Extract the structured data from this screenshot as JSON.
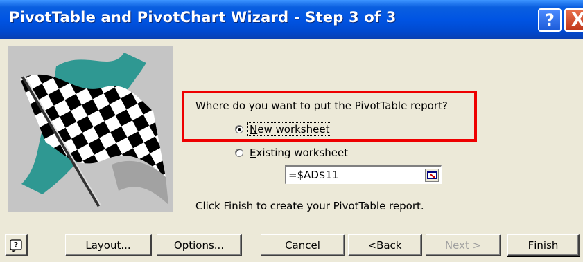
{
  "window": {
    "title": "PivotTable and PivotChart Wizard - Step 3 of 3",
    "help_glyph": "?",
    "close_glyph": "X"
  },
  "main": {
    "prompt": "Where do you want to put the PivotTable report?",
    "options": [
      {
        "mnemonic": "N",
        "rest": "ew worksheet",
        "selected": true
      },
      {
        "mnemonic": "E",
        "rest": "xisting worksheet",
        "selected": false
      }
    ],
    "reference_value": "=$AD$11",
    "hint": "Click Finish to create your PivotTable report."
  },
  "buttons": {
    "layout": {
      "mnemonic": "L",
      "rest": "ayout..."
    },
    "options": {
      "mnemonic": "O",
      "rest": "ptions..."
    },
    "cancel": {
      "label": "Cancel"
    },
    "back": {
      "prefix": "< ",
      "mnemonic": "B",
      "rest": "ack"
    },
    "next": {
      "label": "Next >",
      "disabled": true
    },
    "finish": {
      "mnemonic": "F",
      "rest": "inish"
    }
  },
  "colors": {
    "titlebar": "#0054e3",
    "dialog_bg": "#ece9d8",
    "highlight_border": "#ee0000"
  }
}
